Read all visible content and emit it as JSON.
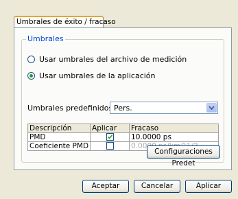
{
  "tab": {
    "label": "Umbrales de éxito / fracaso"
  },
  "group": {
    "title": "Umbrales",
    "radio_file": "Usar umbrales del archivo de medición",
    "radio_app": "Usar umbrales de la aplicación",
    "selected": "radio_app"
  },
  "presets": {
    "label": "Umbrales predefinidos:",
    "value": "Pers."
  },
  "table": {
    "headers": [
      "Descripción",
      "Aplicar",
      "Fracaso"
    ],
    "rows": [
      {
        "description": "PMD",
        "apply": true,
        "failure": "10.0000 ps"
      },
      {
        "description": "Coeficiente PMD",
        "apply": false,
        "failure": "0.0000 ps/km^1/2"
      }
    ]
  },
  "buttons": {
    "preset_config": "Configuraciones Predet",
    "accept": "Aceptar",
    "cancel": "Cancelar",
    "apply": "Aplicar"
  },
  "colors": {
    "accent_tab": "#e8a430",
    "group_title": "#0046d5",
    "radio_dot": "#21a121"
  }
}
